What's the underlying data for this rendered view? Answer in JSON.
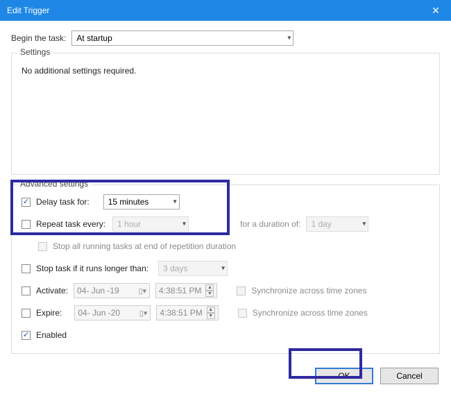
{
  "window": {
    "title": "Edit Trigger"
  },
  "begin": {
    "label": "Begin the task:",
    "value": "At startup"
  },
  "settings": {
    "legend": "Settings",
    "message": "No additional settings required."
  },
  "adv": {
    "legend": "Advanced settings",
    "delay": {
      "label": "Delay task for:",
      "value": "15 minutes",
      "checked": true
    },
    "repeat": {
      "label": "Repeat task every:",
      "value": "1 hour",
      "checked": false,
      "duration_label": "for a duration of:",
      "duration_value": "1 day"
    },
    "stop_rep": {
      "label": "Stop all running tasks at end of repetition duration",
      "checked": false
    },
    "stop_long": {
      "label": "Stop task if it runs longer than:",
      "value": "3 days",
      "checked": false
    },
    "activate": {
      "label": "Activate:",
      "date": "04- Jun -19",
      "time": "4:38:51 PM",
      "sync_label": "Synchronize across time zones",
      "sync_checked": false,
      "checked": false
    },
    "expire": {
      "label": "Expire:",
      "date": "04- Jun -20",
      "time": "4:38:51 PM",
      "sync_label": "Synchronize across time zones",
      "sync_checked": false,
      "checked": false
    },
    "enabled": {
      "label": "Enabled",
      "checked": true
    }
  },
  "buttons": {
    "ok": "OK",
    "cancel": "Cancel"
  }
}
